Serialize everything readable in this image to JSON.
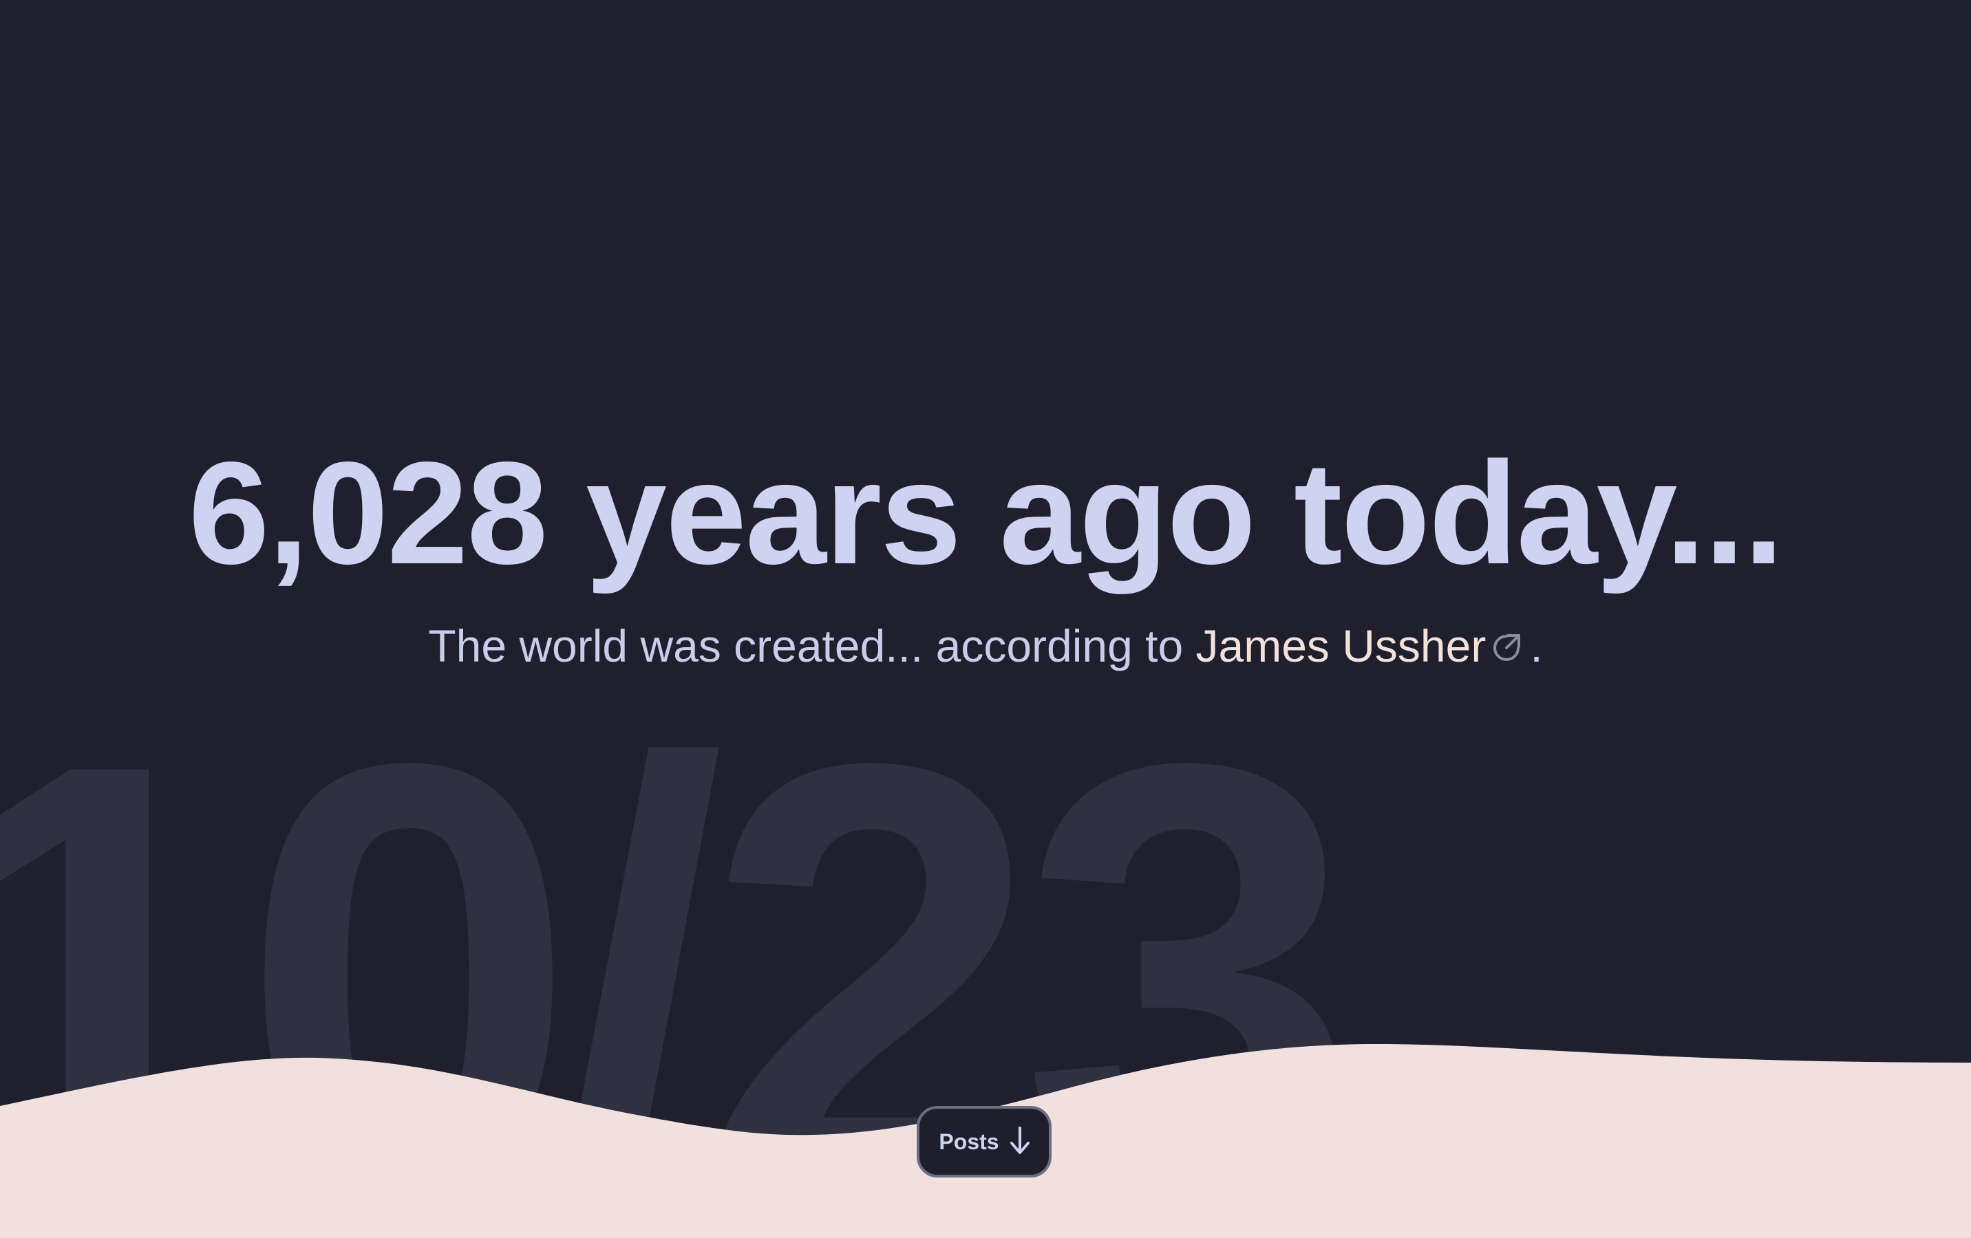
{
  "background_date": "10/23",
  "hero": {
    "title": "6,028 years ago today...",
    "subtitle_prefix": "The world was created... according to ",
    "link_text": "James Ussher",
    "link_icon": "external-link-icon",
    "subtitle_suffix": "."
  },
  "posts_button": {
    "label": "Posts",
    "icon": "arrow-down-icon"
  },
  "colors": {
    "background": "#1f1f2d",
    "title": "#cdd3f0",
    "link": "#f3e1dc",
    "wave": "#f1e1de",
    "bg_date": "#2f3040"
  }
}
